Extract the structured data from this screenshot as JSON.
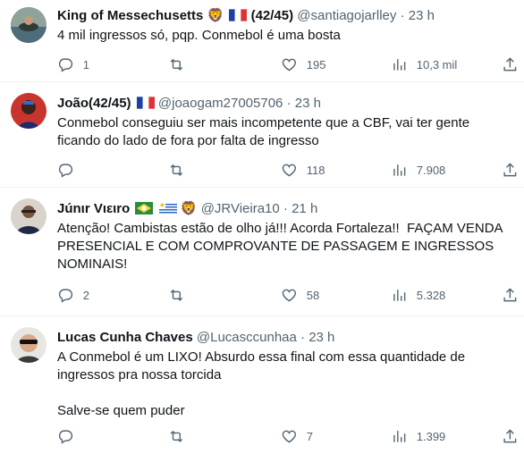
{
  "tweets": [
    {
      "name": "King of Messechusetts",
      "emoji": "🦁",
      "extra": "(42/45)",
      "handle": "@santiagojarlley",
      "time": "23 h",
      "text": "4 mil ingressos só, pqp. Conmebol é uma bosta",
      "replies": "1",
      "retweets": "",
      "likes": "195",
      "views": "10,3 mil"
    },
    {
      "name": "João(42/45)",
      "handle": "@joaogam27005706",
      "time": "23 h",
      "text": "Conmebol conseguiu ser mais incompetente que a CBF, vai ter gente ficando do lado de fora por falta de ingresso",
      "replies": "",
      "retweets": "",
      "likes": "118",
      "views": "7.908"
    },
    {
      "name": "Júnιr Vιειro",
      "emoji": "🦁",
      "handle": "@JRVieira10",
      "time": "21 h",
      "text": "Atenção! Cambistas estão de olho já!!! Acorda Fortaleza!!  FAÇAM VENDA PRESENCIAL E COM COMPROVANTE DE PASSAGEM E INGRESSOS NOMINAIS!",
      "replies": "2",
      "retweets": "",
      "likes": "58",
      "views": "5.328"
    },
    {
      "name": "Lucas Cunha Chaves",
      "handle": "@Lucasccunhaa",
      "time": "23 h",
      "text": "A Conmebol é um LIXO! Absurdo essa final com essa quantidade de ingressos pra nossa torcida\n\nSalve-se quem puder",
      "replies": "",
      "retweets": "",
      "likes": "7",
      "views": "1.399"
    }
  ],
  "dot": "·"
}
